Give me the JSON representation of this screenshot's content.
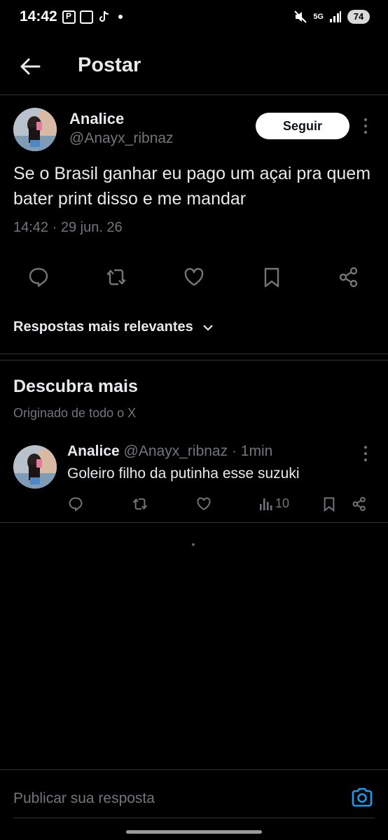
{
  "status_bar": {
    "time": "14:42",
    "network": "5G",
    "battery": "74"
  },
  "header": {
    "title": "Postar",
    "back_icon": "arrow-left-icon"
  },
  "tweet": {
    "author_name": "Analice",
    "author_handle": "@Anayx_ribnaz",
    "follow_label": "Seguir",
    "text": "Se o Brasil ganhar eu pago um açai pra quem bater print disso e me mandar",
    "timestamp": "14:42 · 29 jun. 26",
    "actions": [
      "reply-icon",
      "retweet-icon",
      "like-icon",
      "bookmark-icon",
      "share-icon"
    ]
  },
  "replies_sort": {
    "label": "Respostas mais relevantes"
  },
  "discover": {
    "title": "Descubra mais",
    "subtitle": "Originado de todo o X",
    "posts": [
      {
        "author_name": "Analice",
        "author_handle": "@Anayx_ribnaz",
        "time": "· 1min",
        "text": "Goleiro filho da putinha esse suzuki",
        "views": "10"
      }
    ]
  },
  "reply_bar": {
    "placeholder": "Publicar sua resposta"
  },
  "colors": {
    "background": "#000000",
    "text_primary": "#e7e9ea",
    "text_secondary": "#71767b",
    "divider": "#2f3336",
    "accent": "#1d9bf0"
  }
}
